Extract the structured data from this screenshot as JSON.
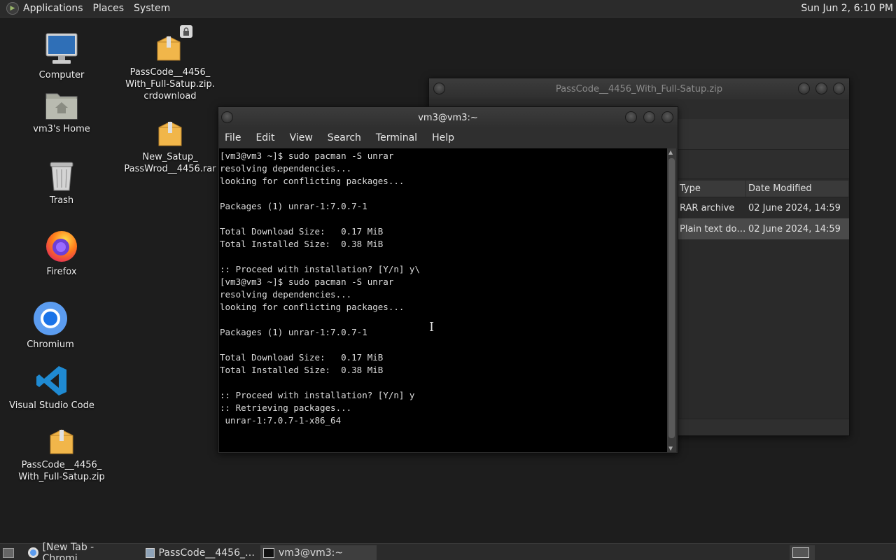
{
  "top_panel": {
    "menus": [
      "Applications",
      "Places",
      "System"
    ],
    "clock": "Sun Jun  2,  6:10 PM"
  },
  "desktop": {
    "computer": "Computer",
    "home": "vm3's Home",
    "trash": "Trash",
    "firefox": "Firefox",
    "chromium": "Chromium",
    "vscode": "Visual Studio Code",
    "zip_bottom": "PassCode__4456_\nWith_Full-Satup.zip",
    "crdownload": "PassCode__4456_\nWith_Full-Satup.zip.\ncrdownload",
    "rar": "New_Satup_\nPassWrod__4456.rar"
  },
  "file_manager": {
    "title": "PassCode__4456_With_Full-Satup.zip",
    "columns": [
      "Type",
      "Date Modified"
    ],
    "rows": [
      {
        "type": "RAR archive",
        "date": "02 June 2024, 14:59"
      },
      {
        "type": "Plain text do…",
        "date": "02 June 2024, 14:59"
      }
    ]
  },
  "terminal": {
    "title": "vm3@vm3:~",
    "menu": [
      "File",
      "Edit",
      "View",
      "Search",
      "Terminal",
      "Help"
    ],
    "lines": [
      "[vm3@vm3 ~]$ sudo pacman -S unrar",
      "resolving dependencies...",
      "looking for conflicting packages...",
      "",
      "Packages (1) unrar-1:7.0.7-1",
      "",
      "Total Download Size:   0.17 MiB",
      "Total Installed Size:  0.38 MiB",
      "",
      ":: Proceed with installation? [Y/n] y\\",
      "[vm3@vm3 ~]$ sudo pacman -S unrar",
      "resolving dependencies...",
      "looking for conflicting packages...",
      "",
      "Packages (1) unrar-1:7.0.7-1",
      "",
      "Total Download Size:   0.17 MiB",
      "Total Installed Size:  0.38 MiB",
      "",
      ":: Proceed with installation? [Y/n] y",
      ":: Retrieving packages...",
      " unrar-1:7.0.7-1-x86_64"
    ]
  },
  "taskbar": {
    "tasks": [
      "[New Tab - Chromi…",
      "PassCode__4456_…",
      "vm3@vm3:~"
    ]
  }
}
